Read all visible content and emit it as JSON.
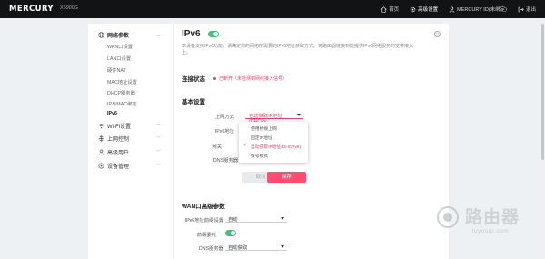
{
  "header": {
    "logo": "MERCURY",
    "model": "X6900G",
    "nav": [
      {
        "label": "首页",
        "icon": "home-icon"
      },
      {
        "label": "高级设置",
        "icon": "gear-icon"
      },
      {
        "label": "MERCURY ID(未绑定)",
        "icon": "user-icon"
      },
      {
        "label": "退出",
        "icon": "logout-icon"
      }
    ]
  },
  "sidebar": {
    "network": {
      "label": "网络参数",
      "icon": "globe-icon"
    },
    "subitems": [
      "WAN口设置",
      "LAN口设置",
      "硬件NAT",
      "MAC地址设置",
      "DHCP服务器",
      "IP与MAC绑定",
      "IPv6"
    ],
    "wifi": {
      "label": "Wi-Fi设置",
      "icon": "wifi-icon"
    },
    "internet": {
      "label": "上网控制",
      "icon": "control-icon"
    },
    "guest": {
      "label": "高级用户",
      "icon": "user-icon"
    },
    "device": {
      "label": "设备管理",
      "icon": "device-icon"
    }
  },
  "main": {
    "title": "IPv6",
    "description": "本设备支持IPv6功能，请确定您的网络所需要的IPv6地址获取方式。将路由器链接到能提供IPv6网络服务的宽带接入上。",
    "connection": {
      "heading": "连接状态",
      "status": "已断开（未检测到网线接入信号）"
    },
    "basic": {
      "heading": "基本设置",
      "mode_label": "上网方式",
      "mode_value": "自动获取IP地址(DHCPv...",
      "addr_label": "IPv6地址",
      "gateway_label": "网关",
      "dns_label": "DNS服务器",
      "options": [
        "使用桥接上网",
        "固定IP地址",
        "自动获取IP地址(DHCPv6)",
        "拨号模式"
      ],
      "selected_index": 2
    },
    "buttons": {
      "cancel": "取消",
      "save": "保存"
    },
    "wan_adv": {
      "heading": "WAN口高级参数",
      "prefix_label": "IPv6地址前缀设置",
      "prefix_value": "自动",
      "relay_label": "前缀委托",
      "dns_label": "DNS服务器",
      "dns_value": "自动获取"
    }
  },
  "watermark": {
    "main": "路由器",
    "sub": "luyouqi.com"
  },
  "colors": {
    "accent": "#e2436a",
    "button": "#ff4c72",
    "toggle": "#3fc279",
    "topbar": "#111315"
  }
}
